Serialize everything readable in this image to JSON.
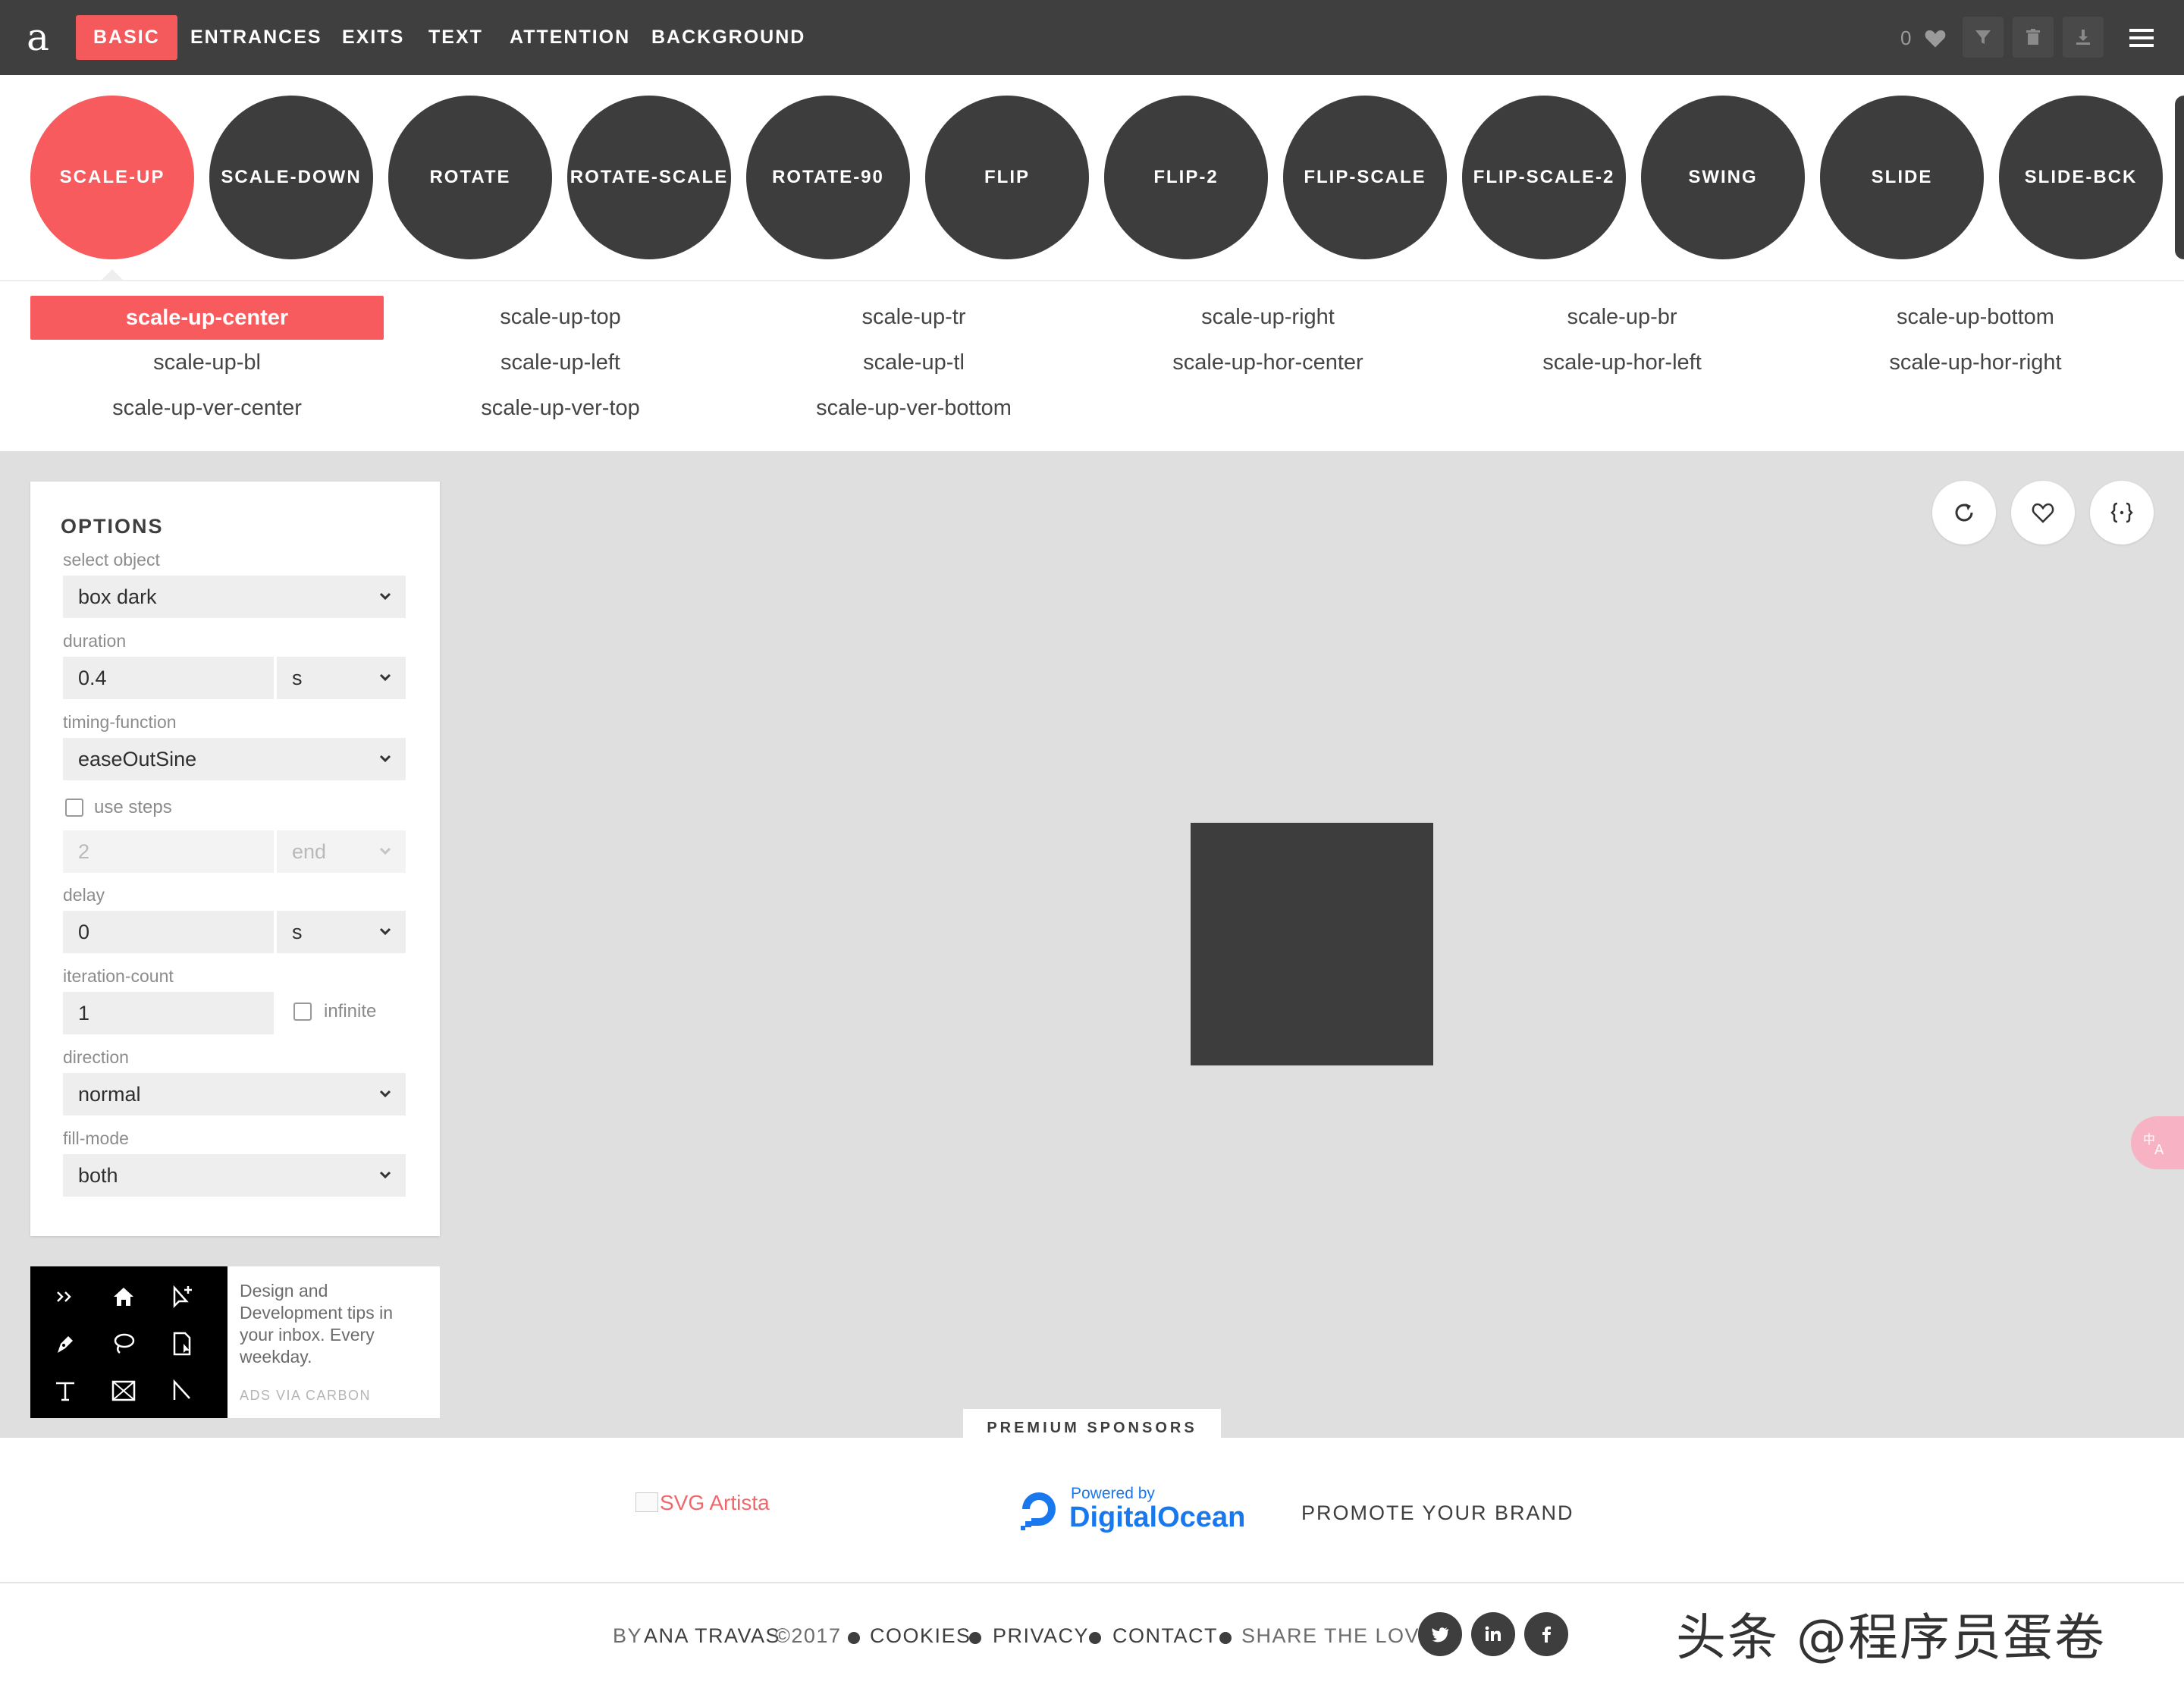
{
  "nav": {
    "logo": "a",
    "items": [
      "BASIC",
      "ENTRANCES",
      "EXITS",
      "TEXT",
      "ATTENTION",
      "BACKGROUND"
    ],
    "active": "BASIC",
    "likes_count": "0",
    "toolbar_icons": [
      "filter-icon",
      "trash-icon",
      "download-icon",
      "menu-icon"
    ]
  },
  "groups": {
    "items": [
      "SCALE-UP",
      "SCALE-DOWN",
      "ROTATE",
      "ROTATE-SCALE",
      "ROTATE-90",
      "FLIP",
      "FLIP-2",
      "FLIP-SCALE",
      "FLIP-SCALE-2",
      "SWING",
      "SLIDE",
      "SLIDE-BCK"
    ],
    "active": "SCALE-UP"
  },
  "variations": {
    "items": [
      "scale-up-center",
      "scale-up-top",
      "scale-up-tr",
      "scale-up-right",
      "scale-up-br",
      "scale-up-bottom",
      "scale-up-bl",
      "scale-up-left",
      "scale-up-tl",
      "scale-up-hor-center",
      "scale-up-hor-left",
      "scale-up-hor-right",
      "scale-up-ver-center",
      "scale-up-ver-top",
      "scale-up-ver-bottom"
    ],
    "active": "scale-up-center"
  },
  "options": {
    "title": "OPTIONS",
    "select_object_label": "select object",
    "select_object_value": "box dark",
    "duration_label": "duration",
    "duration_value": "0.4",
    "duration_unit": "s",
    "timing_label": "timing-function",
    "timing_value": "easeOutSine",
    "use_steps_label": "use steps",
    "use_steps_checked": false,
    "steps_value": "2",
    "steps_position": "end",
    "delay_label": "delay",
    "delay_value": "0",
    "delay_unit": "s",
    "iteration_label": "iteration-count",
    "iteration_value": "1",
    "infinite_label": "infinite",
    "infinite_checked": false,
    "direction_label": "direction",
    "direction_value": "normal",
    "fillmode_label": "fill-mode",
    "fillmode_value": "both"
  },
  "carbon": {
    "text": "Design and Development tips in your inbox. Every weekday.",
    "via": "ADS VIA CARBON"
  },
  "stage": {
    "actions": [
      "replay-icon",
      "heart-icon",
      "code-icon"
    ],
    "object_color": "#3d3d3d"
  },
  "sponsors": {
    "tab_label": "PREMIUM SPONSORS",
    "svg_artista": "SVG Artista",
    "do_powered": "Powered by",
    "do_name": "DigitalOcean",
    "promote": "PROMOTE YOUR BRAND"
  },
  "footer": {
    "by": "BY",
    "author": "ANA TRAVAS",
    "year": "©2017",
    "cookies": "COOKIES",
    "privacy": "PRIVACY",
    "contact": "CONTACT",
    "share": "SHARE THE LOVE",
    "social": [
      "twitter-icon",
      "linkedin-icon",
      "facebook-icon"
    ],
    "watermark": "头条 @程序员蛋卷"
  },
  "colors": {
    "accent": "#f75b5e",
    "dark": "#3d3d3d",
    "topbar": "#3f3f3f",
    "stage_bg": "#dfdfdf",
    "digitalocean": "#1978ee"
  }
}
